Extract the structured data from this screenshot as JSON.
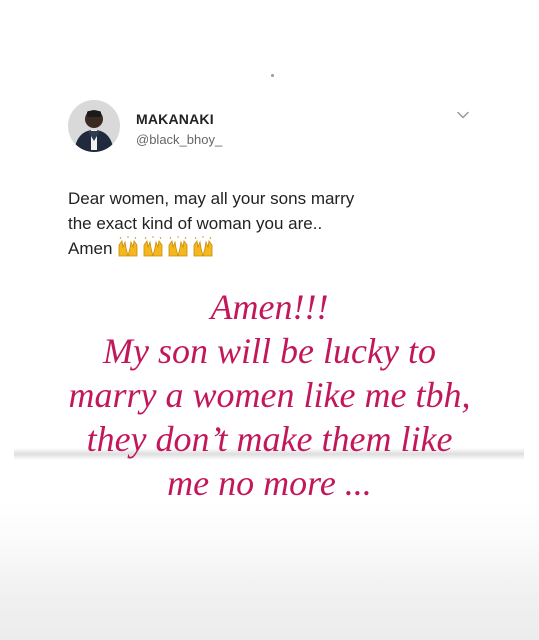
{
  "tweet": {
    "display_name": "MAKANAKI",
    "handle": "@black_bhoy_",
    "text_lines": [
      "Dear women, may all your sons marry",
      "the exact kind of woman you are..",
      "Amen"
    ],
    "emoji": [
      "raised-hands-icon",
      "raised-hands-icon",
      "raised-hands-icon",
      "raised-hands-icon"
    ]
  },
  "caption": {
    "lines": [
      "Amen!!!",
      "My son will be lucky to",
      "marry a women like me tbh,",
      "they don’t make them like",
      "me no more ..."
    ]
  },
  "colors": {
    "caption_text": "#c2185b",
    "tweet_text": "#222222",
    "handle_text": "#666666",
    "emoji_yellow": "#f4b71e"
  }
}
